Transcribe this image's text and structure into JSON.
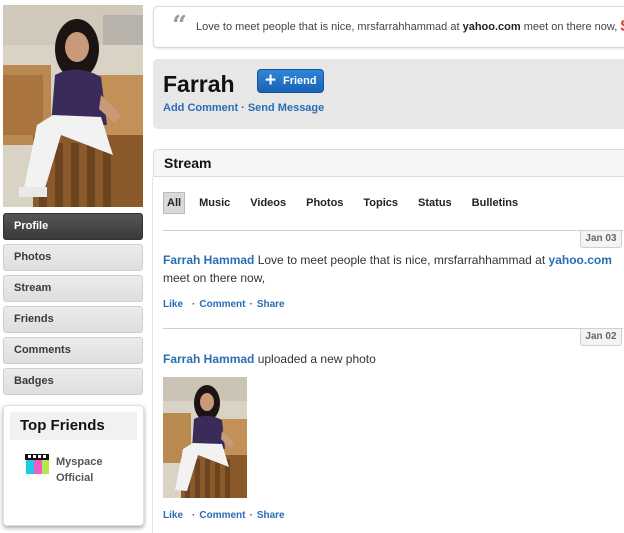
{
  "mood": {
    "text_before": "Love to meet people that is nice, mrsfarrahhammad at ",
    "text_bold": "yahoo.com",
    "text_after": " meet on there now,",
    "more_glyph": "S"
  },
  "profile": {
    "name": "Farrah",
    "friend_button": "Friend",
    "add_comment": "Add Comment",
    "send_message": "Send Message",
    "separator": "·"
  },
  "sidebar": {
    "items": [
      {
        "label": "Profile",
        "active": true
      },
      {
        "label": "Photos"
      },
      {
        "label": "Stream"
      },
      {
        "label": "Friends"
      },
      {
        "label": "Comments"
      },
      {
        "label": "Badges"
      }
    ]
  },
  "top_friends": {
    "title": "Top Friends",
    "friends": [
      {
        "name": "Myspace Official"
      }
    ]
  },
  "stream": {
    "title": "Stream",
    "tabs": [
      "All",
      "Music",
      "Videos",
      "Photos",
      "Topics",
      "Status",
      "Bulletins"
    ],
    "active_tab": "All",
    "entries": [
      {
        "date": "Jan 03",
        "author": "Farrah Hammad",
        "text_before": " Love to meet people that is nice, mrsfarrahhammad at ",
        "link": "yahoo.com",
        "text_after": "meet on there now,",
        "actions": [
          "Like",
          "Comment",
          "Share"
        ]
      },
      {
        "date": "Jan 02",
        "author": "Farrah Hammad",
        "text": " uploaded a new photo",
        "actions": [
          "Like",
          "Comment",
          "Share"
        ]
      }
    ]
  },
  "colors": {
    "link_blue": "#2a6db5",
    "button_blue": "#1a63b5",
    "nav_active": "#3a3a3a",
    "header_bg": "#e7e7e7"
  },
  "icons": {
    "quote": "quote-icon",
    "plus": "plus-icon"
  }
}
